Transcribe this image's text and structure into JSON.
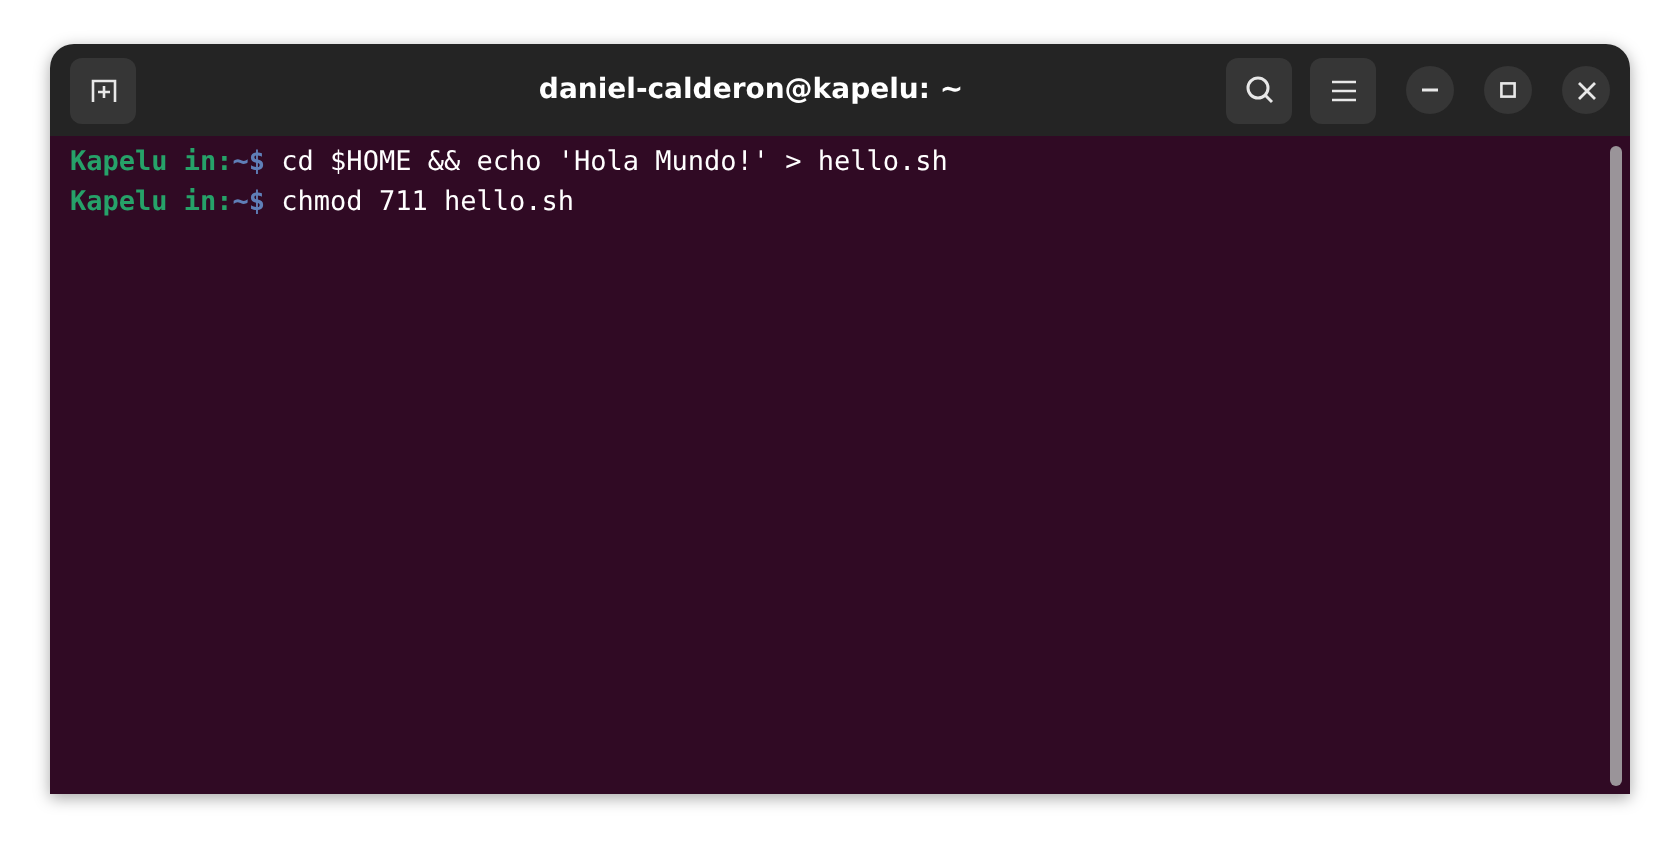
{
  "window": {
    "title": "daniel-calderon@kapelu: ~"
  },
  "terminal": {
    "lines": [
      {
        "user": "Kapelu in:",
        "path": "~$",
        "command": " cd $HOME && echo 'Hola Mundo!' > hello.sh"
      },
      {
        "user": "Kapelu in:",
        "path": "~$",
        "command": " chmod 711 hello.sh"
      }
    ]
  }
}
